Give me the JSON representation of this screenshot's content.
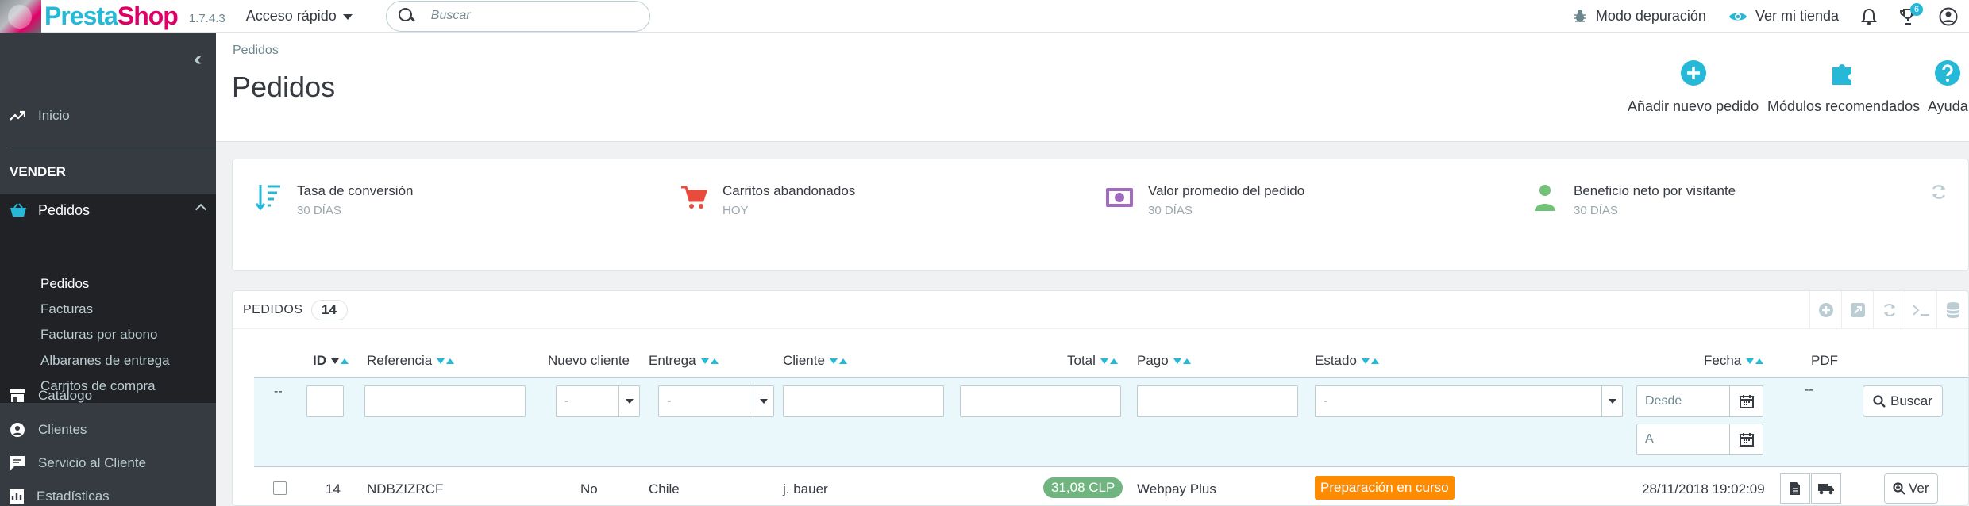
{
  "topbar": {
    "logo_text_a": "Presta",
    "logo_text_b": "Shop",
    "version": "1.7.4.3",
    "quick_access": "Acceso rápido",
    "search_placeholder": "Buscar",
    "debug_mode": "Modo depuración",
    "view_store": "Ver mi tienda",
    "trophy_badge": "6"
  },
  "sidebar": {
    "home": "Inicio",
    "section": "VENDER",
    "orders": "Pedidos",
    "sub": [
      "Pedidos",
      "Facturas",
      "Facturas por abono",
      "Albaranes de entrega",
      "Carritos de compra"
    ],
    "catalog": "Catálogo",
    "customers": "Clientes",
    "customer_service": "Servicio al Cliente",
    "stats": "Estadísticas"
  },
  "header": {
    "breadcrumb": "Pedidos",
    "title": "Pedidos",
    "add_order": "Añadir nuevo pedido",
    "recommended_modules": "Módulos recomendados",
    "help": "Ayuda"
  },
  "kpis": [
    {
      "title": "Tasa de conversión",
      "sub": "30 DÍAS",
      "icon": "sort-amount-icon",
      "color": "#25b9d7"
    },
    {
      "title": "Carritos abandonados",
      "sub": "HOY",
      "icon": "cart-icon",
      "color": "#e74c3c"
    },
    {
      "title": "Valor promedio del pedido",
      "sub": "30 DÍAS",
      "icon": "money-icon",
      "color": "#8e44ad"
    },
    {
      "title": "Beneficio neto por visitante",
      "sub": "30 DÍAS",
      "icon": "user-icon",
      "color": "#72c279"
    }
  ],
  "panel": {
    "title": "PEDIDOS",
    "count": "14",
    "columns": {
      "id": "ID",
      "reference": "Referencia",
      "new_customer": "Nuevo cliente",
      "delivery": "Entrega",
      "customer": "Cliente",
      "total": "Total",
      "payment": "Pago",
      "status": "Estado",
      "date": "Fecha",
      "pdf": "PDF"
    },
    "filters": {
      "dash_left": "--",
      "new_customer_value": "-",
      "delivery_value": "-",
      "status_value": "-",
      "date_from_placeholder": "Desde",
      "date_to_placeholder": "A",
      "pdf_dash": "--",
      "search_button": "Buscar"
    },
    "rows": [
      {
        "id": "14",
        "reference": "NDBZIZRCF",
        "new_customer": "No",
        "delivery": "Chile",
        "customer": "j. bauer",
        "total": "31,08 CLP",
        "payment": "Webpay Plus",
        "status": "Preparación en curso",
        "date": "28/11/2018 19:02:09",
        "view_button": "Ver"
      }
    ]
  },
  "colors": {
    "accent": "#25b9d7",
    "sidebar_bg": "#363a41",
    "total_badge": "#70b580",
    "status_badge": "#ff8c00"
  }
}
